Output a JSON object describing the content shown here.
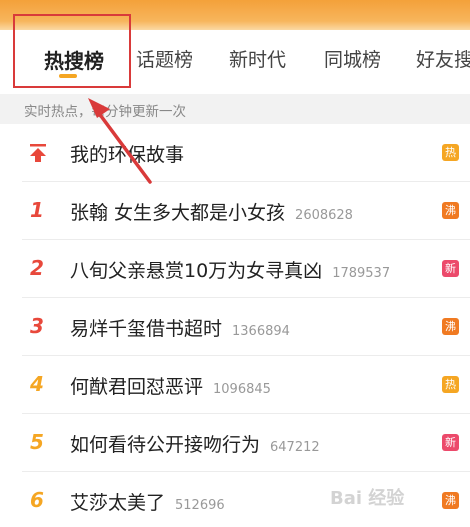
{
  "tabs": [
    {
      "label": "热搜榜"
    },
    {
      "label": "话题榜"
    },
    {
      "label": "新时代"
    },
    {
      "label": "同城榜"
    },
    {
      "label": "好友搜"
    }
  ],
  "subheader": "实时热点，每分钟更新一次",
  "items": [
    {
      "rank": "",
      "title": "我的环保故事",
      "count": "",
      "badge": "热",
      "badge_color": "#f5a623"
    },
    {
      "rank": "1",
      "title": "张翰 女生多大都是小女孩",
      "count": "2608628",
      "badge": "沸",
      "badge_color": "#f07a22"
    },
    {
      "rank": "2",
      "title": "八旬父亲悬赏10万为女寻真凶",
      "count": "1789537",
      "badge": "新",
      "badge_color": "#ec4a6b"
    },
    {
      "rank": "3",
      "title": "易烊千玺借书超时",
      "count": "1366894",
      "badge": "沸",
      "badge_color": "#f07a22"
    },
    {
      "rank": "4",
      "title": "何猷君回怼恶评",
      "count": "1096845",
      "badge": "热",
      "badge_color": "#f5a623"
    },
    {
      "rank": "5",
      "title": "如何看待公开接吻行为",
      "count": "647212",
      "badge": "新",
      "badge_color": "#ec4a6b"
    },
    {
      "rank": "6",
      "title": "艾莎太美了",
      "count": "512696",
      "badge": "沸",
      "badge_color": "#f07a22"
    }
  ],
  "colors": {
    "rank_top3": "#e8483b",
    "rank_other": "#f5a623",
    "accent": "#f5a623",
    "annotation": "#d93a3a"
  },
  "icons": {
    "pinned": "pin-top-icon",
    "annotation": "red-arrow-icon"
  },
  "watermark": "Bai 经验"
}
